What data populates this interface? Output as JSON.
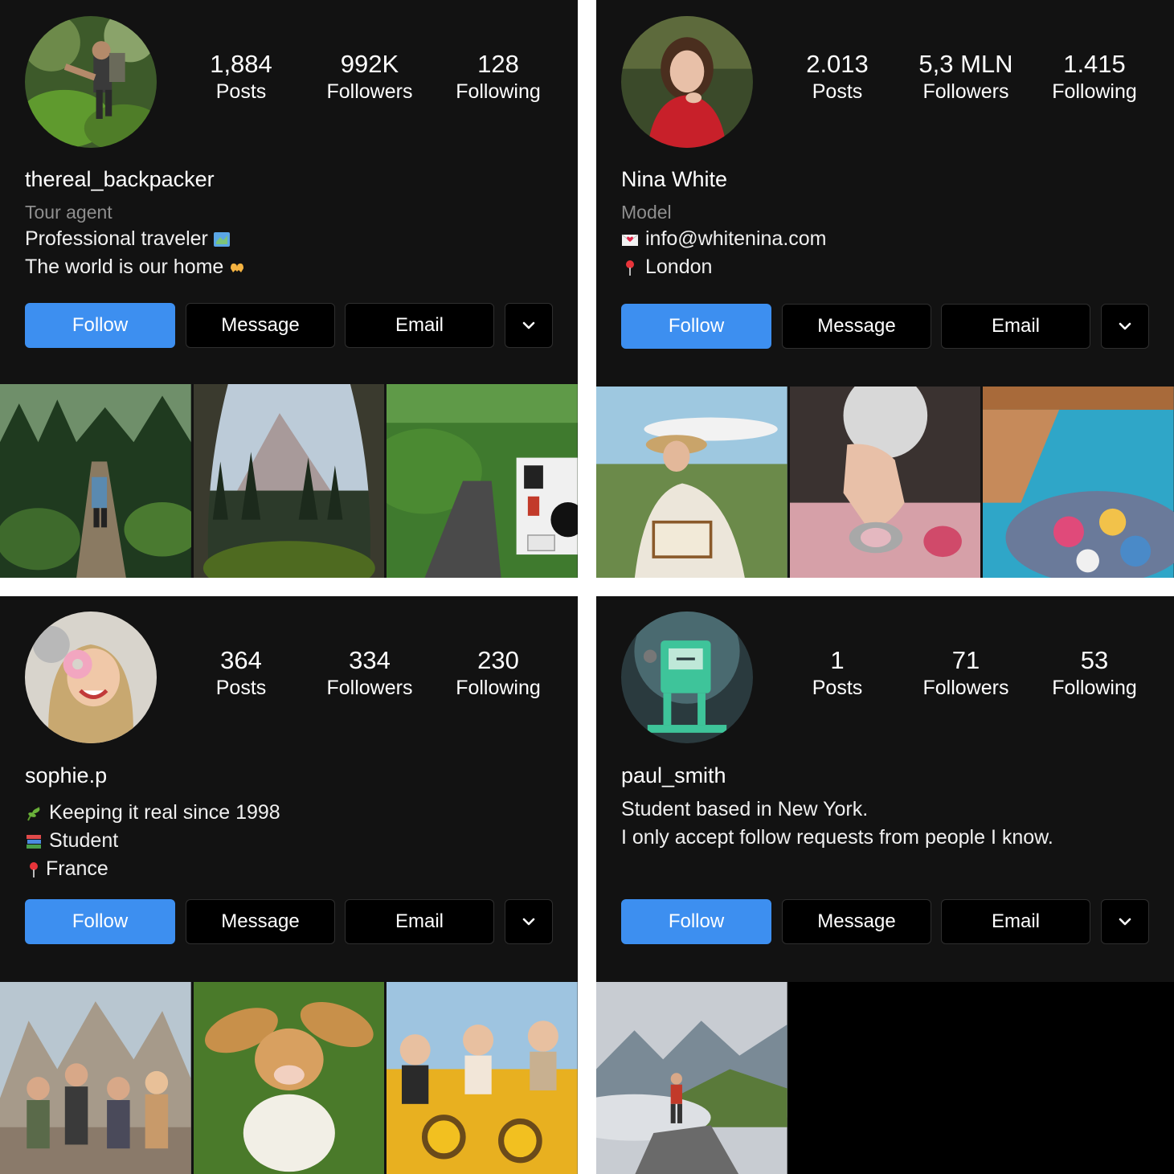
{
  "profiles": [
    {
      "username": "thereal_backpacker",
      "category": "Tour agent",
      "bio": [
        {
          "text": "Professional traveler",
          "icon": "map-emoji-icon",
          "icon_pos": "after"
        },
        {
          "text": "The world is our home",
          "icon": "heart-hands-emoji-icon",
          "icon_pos": "after"
        }
      ],
      "stats": {
        "posts": "1,884",
        "posts_label": "Posts",
        "followers": "992K",
        "followers_label": "Followers",
        "following": "128",
        "following_label": "Following"
      },
      "buttons": {
        "follow": "Follow",
        "message": "Message",
        "email": "Email",
        "more_icon": "chevron-down-icon"
      }
    },
    {
      "username": "Nina White",
      "category": "Model",
      "bio": [
        {
          "text": "info@whitenina.com",
          "icon": "love-letter-emoji-icon",
          "icon_pos": "before"
        },
        {
          "text": "London",
          "icon": "pin-emoji-icon",
          "icon_pos": "before"
        }
      ],
      "stats": {
        "posts": "2.013",
        "posts_label": "Posts",
        "followers": "5,3 MLN",
        "followers_label": "Followers",
        "following": "1.415",
        "following_label": "Following"
      },
      "buttons": {
        "follow": "Follow",
        "message": "Message",
        "email": "Email",
        "more_icon": "chevron-down-icon"
      }
    },
    {
      "username": "sophie.p",
      "category": "",
      "bio": [
        {
          "text": "Keeping it real since 1998",
          "icon": "herb-emoji-icon",
          "icon_pos": "before"
        },
        {
          "text": "Student",
          "icon": "books-emoji-icon",
          "icon_pos": "before"
        },
        {
          "text": "France",
          "icon": "pin-emoji-icon",
          "icon_pos": "before"
        }
      ],
      "stats": {
        "posts": "364",
        "posts_label": "Posts",
        "followers": "334",
        "followers_label": "Followers",
        "following": "230",
        "following_label": "Following"
      },
      "buttons": {
        "follow": "Follow",
        "message": "Message",
        "email": "Email",
        "more_icon": "chevron-down-icon"
      }
    },
    {
      "username": "paul_smith",
      "category": "",
      "bio": [
        {
          "text": "Student based in New York.",
          "icon": "",
          "icon_pos": ""
        },
        {
          "text": "I only accept follow requests from people I know.",
          "icon": "",
          "icon_pos": ""
        }
      ],
      "stats": {
        "posts": "1",
        "posts_label": "Posts",
        "followers": "71",
        "followers_label": "Followers",
        "following": "53",
        "following_label": "Following"
      },
      "buttons": {
        "follow": "Follow",
        "message": "Message",
        "email": "Email",
        "more_icon": "chevron-down-icon"
      }
    }
  ],
  "colors": {
    "background": "#121212",
    "follow_button": "#3d8ff0",
    "category_text": "#8e8e8e"
  }
}
